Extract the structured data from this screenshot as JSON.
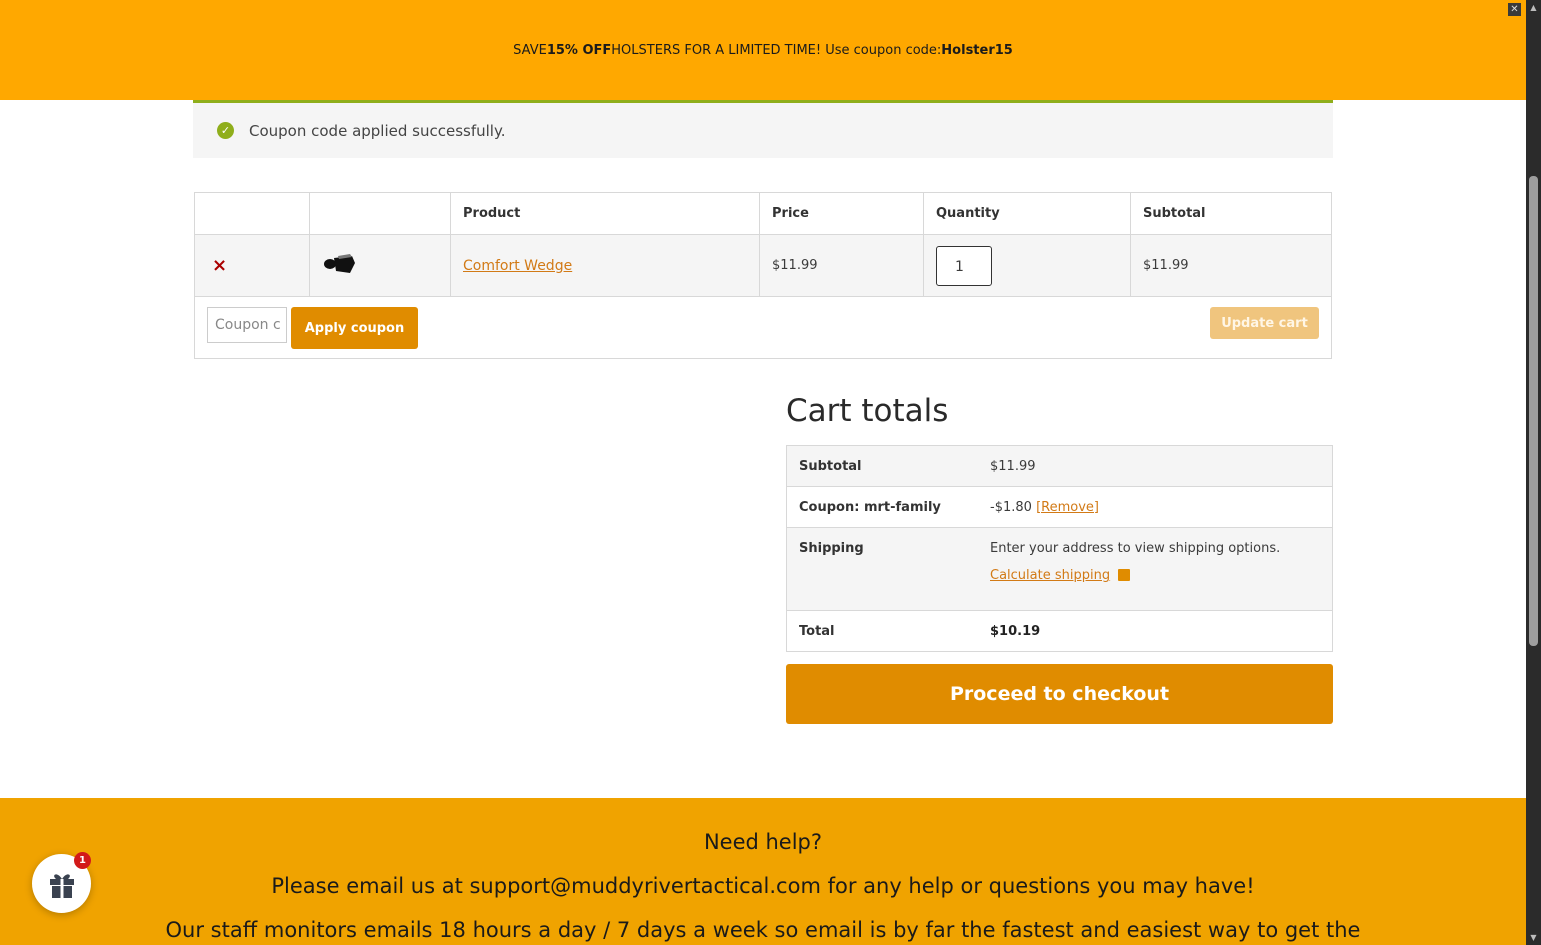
{
  "promo": {
    "prefix": "SAVE ",
    "highlight": "15% OFF",
    "middle": " HOLSTERS FOR A LIMITED TIME! Use coupon code: ",
    "code": "Holster15"
  },
  "notice": {
    "message": "Coupon code applied successfully."
  },
  "cart": {
    "headers": {
      "product": "Product",
      "price": "Price",
      "quantity": "Quantity",
      "subtotal": "Subtotal"
    },
    "items": [
      {
        "remove": "×",
        "name": "Comfort Wedge",
        "price": "$11.99",
        "quantity": "1",
        "subtotal": "$11.99"
      }
    ],
    "coupon_placeholder": "Coupon c",
    "apply_label": "Apply coupon",
    "update_label": "Update cart"
  },
  "totals": {
    "title": "Cart totals",
    "subtotal_label": "Subtotal",
    "subtotal_value": "$11.99",
    "coupon_label": "Coupon: mrt-family",
    "coupon_value": "-$1.80",
    "coupon_remove": "[Remove]",
    "shipping_label": "Shipping",
    "shipping_text": "Enter your address to view shipping options.",
    "shipping_link": "Calculate shipping",
    "total_label": "Total",
    "total_value": "$10.19",
    "checkout_label": "Proceed to checkout"
  },
  "help": {
    "title": "Need help?",
    "email_line": "Please email us at support@muddyrivertactical.com for any help or questions you may have!",
    "staff_line": "Our staff monitors emails 18 hours a day / 7 days a week so email is by far the fastest and easiest way to get the"
  },
  "gift": {
    "badge": "1"
  },
  "colors": {
    "banner": "#ffa800",
    "accent": "#e08c00",
    "link": "#d27a16",
    "success": "#8fae1b",
    "footer": "#f0a300"
  }
}
